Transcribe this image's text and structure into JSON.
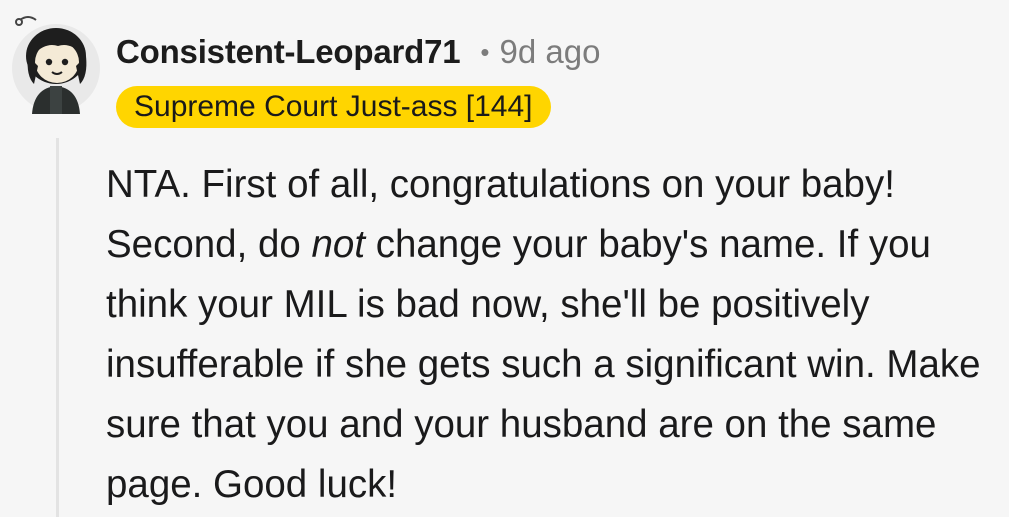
{
  "comment": {
    "author": "Consistent-Leopard71",
    "separator": "•",
    "timestamp": "9d ago",
    "flair": "Supreme Court Just-ass [144]",
    "body": {
      "part1": "NTA. First of all, congratulations on your baby! Second, do ",
      "emphasis": "not",
      "part2": " change your baby's name. If you think your MIL is bad now, she'll be positively insufferable if she gets such a significant win. Make sure that you and your husband are on the same page. Good luck!"
    },
    "avatar_icon": "snoo-avatar-icon"
  },
  "colors": {
    "background": "#f6f6f6",
    "flair_background": "#ffd500",
    "metadata_text": "#7c7c7c",
    "thread_line": "#e3e3e3"
  }
}
